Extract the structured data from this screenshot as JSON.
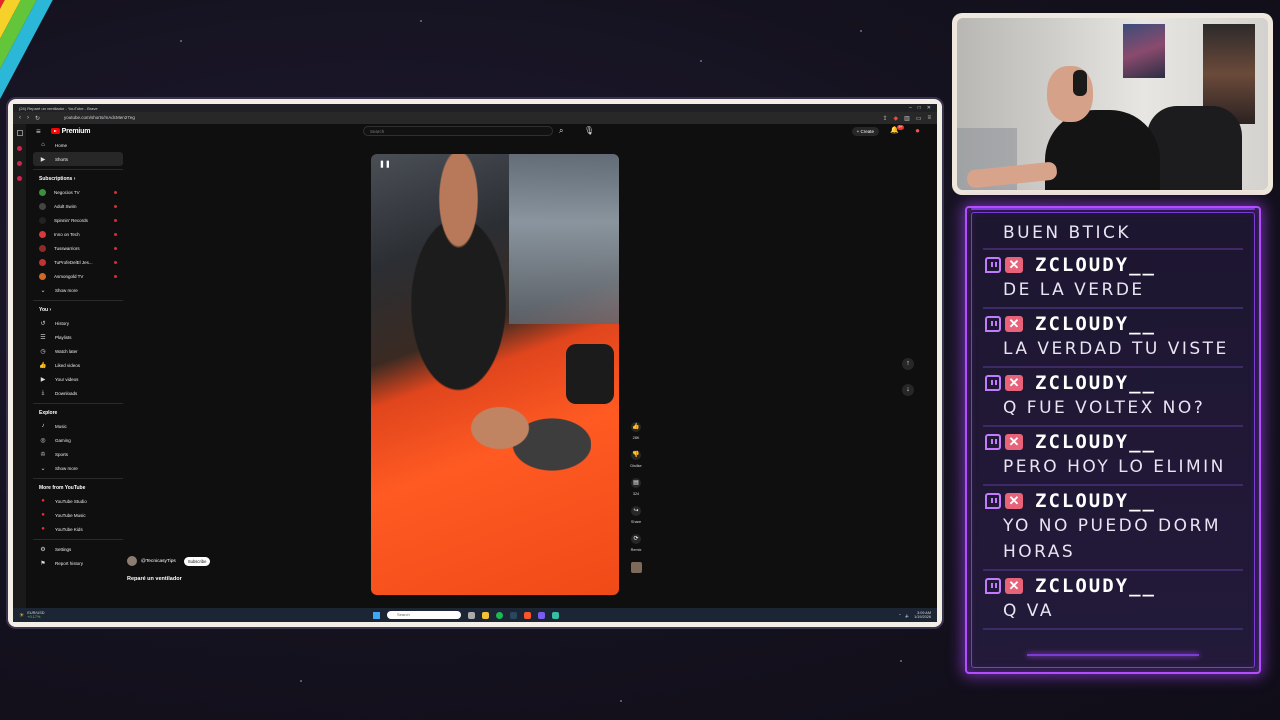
{
  "browser": {
    "title": "(24) Reparé un ventilador - YouTube - Brave",
    "url": "youtube.com/shorts/mAdcMen27eg"
  },
  "youtube": {
    "logo": "Premium",
    "search_placeholder": "Search",
    "create_label": "Create",
    "notification_count": "9+",
    "nav": [
      {
        "label": "Home",
        "icon": "home-icon"
      },
      {
        "label": "Shorts",
        "icon": "shorts-icon"
      }
    ],
    "subscriptions_heading": "Subscriptions",
    "subscriptions": [
      {
        "label": "Negocios TV",
        "color": "#3c8f3c"
      },
      {
        "label": "Adult Swim",
        "color": "#444444"
      },
      {
        "label": "Spinnin' Records",
        "color": "#222222"
      },
      {
        "label": "Inno on Tech",
        "color": "#d63a3a"
      },
      {
        "label": "Tusswarriors",
        "color": "#8b2b2b"
      },
      {
        "label": "TuProfeDelEl Jes...",
        "color": "#c23434"
      },
      {
        "label": "Asmongold TV",
        "color": "#c96b2a"
      }
    ],
    "subs_show_more": "Show more",
    "you_heading": "You",
    "you_items": [
      {
        "label": "History",
        "icon": "history-icon"
      },
      {
        "label": "Playlists",
        "icon": "playlists-icon"
      },
      {
        "label": "Watch later",
        "icon": "clock-icon"
      },
      {
        "label": "Liked videos",
        "icon": "like-icon"
      },
      {
        "label": "Your videos",
        "icon": "video-icon"
      },
      {
        "label": "Downloads",
        "icon": "download-icon"
      }
    ],
    "explore_heading": "Explore",
    "explore_items": [
      {
        "label": "Music",
        "icon": "music-icon"
      },
      {
        "label": "Gaming",
        "icon": "gaming-icon"
      },
      {
        "label": "Sports",
        "icon": "trophy-icon"
      }
    ],
    "explore_show_more": "Show more",
    "more_heading": "More from YouTube",
    "more_items": [
      {
        "label": "YouTube Studio"
      },
      {
        "label": "YouTube Music"
      },
      {
        "label": "YouTube Kids"
      }
    ],
    "settings_items": [
      {
        "label": "Settings",
        "icon": "gear-icon"
      },
      {
        "label": "Report history",
        "icon": "flag-icon"
      }
    ],
    "short": {
      "channel": "@TecnicasyTips",
      "subscribe_label": "Subscribe",
      "title": "Reparé un ventilador",
      "likes": "28K",
      "dislike_label": "Dislike",
      "comments": "324",
      "share_label": "Share",
      "remix_label": "Remix"
    }
  },
  "taskbar": {
    "ticker": "EUR/USD",
    "ticker_change": "+0.17%",
    "search_placeholder": "Search",
    "time": "3:09 AM",
    "date": "1/19/2026"
  },
  "chat": {
    "partial_top": "BUEN BTICK",
    "messages": [
      {
        "user": "ZCLOUDY__",
        "text": "DE LA VERDE"
      },
      {
        "user": "ZCLOUDY__",
        "text": "LA VERDAD TU VISTE"
      },
      {
        "user": "ZCLOUDY__",
        "text": "Q FUE VOLTEX NO?"
      },
      {
        "user": "ZCLOUDY__",
        "text": "PERO HOY LO ELIMIN"
      },
      {
        "user": "ZCLOUDY__",
        "text": "YO NO PUEDO DORM\nHORAS"
      },
      {
        "user": "ZCLOUDY__",
        "text": "Q VA"
      }
    ]
  }
}
